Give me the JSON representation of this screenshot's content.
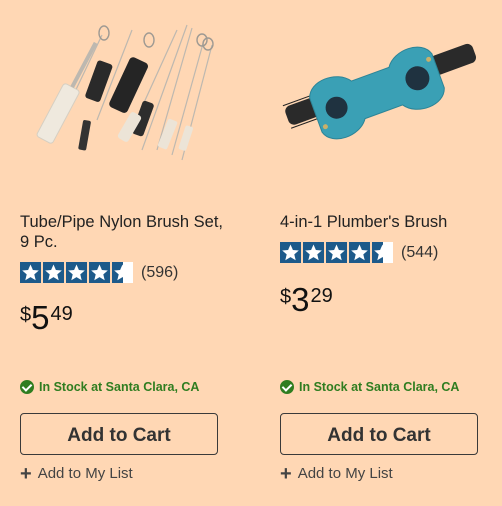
{
  "products": [
    {
      "title": "Tube/Pipe Nylon Brush Set, 9 Pc.",
      "rating": 4.5,
      "review_count": "(596)",
      "price": {
        "currency": "$",
        "dollars": "5",
        "cents": "49"
      },
      "stock": "In Stock at Santa Clara, CA",
      "add_to_cart": "Add to Cart",
      "add_to_list": "Add to My List",
      "image": "brush-set-image"
    },
    {
      "title": "4-in-1 Plumber's Brush",
      "rating": 4.5,
      "review_count": "(544)",
      "price": {
        "currency": "$",
        "dollars": "3",
        "cents": "29"
      },
      "stock": "In Stock at Santa Clara, CA",
      "add_to_cart": "Add to Cart",
      "add_to_list": "Add to My List",
      "image": "plumbers-brush-image"
    }
  ],
  "colors": {
    "background": "#ffd7b4",
    "star": "#1d5a8a",
    "in_stock": "#2f7d20"
  }
}
